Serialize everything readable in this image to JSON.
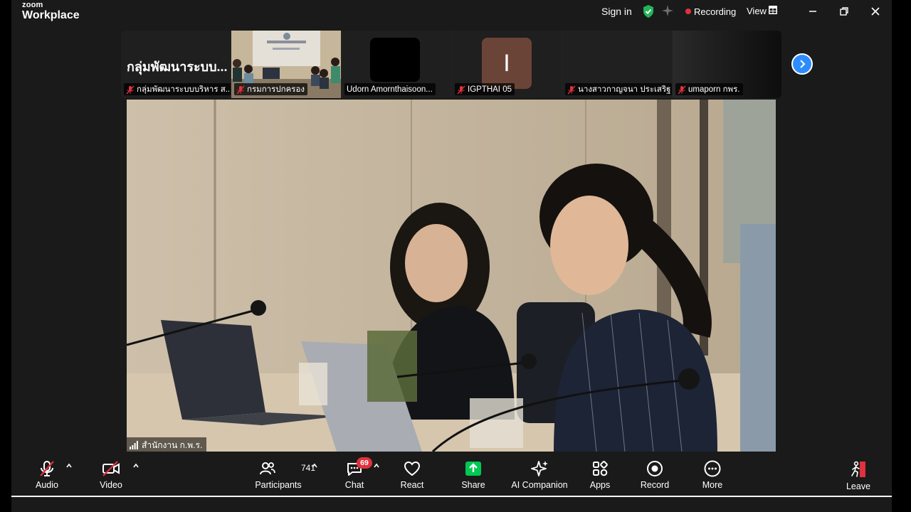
{
  "titlebar": {
    "brand_small": "zoom",
    "brand_large": "Workplace",
    "sign_in": "Sign in",
    "recording": "Recording",
    "view": "View"
  },
  "thumbnails": [
    {
      "name": "กลุ่มพัฒนาระบบบริหาร ส...",
      "big_text": "กลุ่มพัฒนาระบบ...",
      "type": "text"
    },
    {
      "name": "กรมการปกครอง",
      "type": "video"
    },
    {
      "name": "Udorn Amornthaisoon...",
      "type": "black"
    },
    {
      "name": "IGPTHAI 05",
      "avatar_letter": "I",
      "type": "avatar"
    },
    {
      "name": "นางสาวกาญจนา ประเสริฐ ...",
      "type": "empty"
    },
    {
      "name": "umaporn กพร.",
      "type": "dark"
    }
  ],
  "main_video": {
    "name": "สำนักงาน ก.พ.ร."
  },
  "toolbar": {
    "audio": "Audio",
    "video": "Video",
    "participants": "Participants",
    "participants_count": "741",
    "chat": "Chat",
    "chat_badge": "69",
    "react": "React",
    "share": "Share",
    "ai_companion": "AI Companion",
    "apps": "Apps",
    "record": "Record",
    "more": "More",
    "leave": "Leave"
  },
  "colors": {
    "accent_blue": "#2d8cff",
    "recording_red": "#e0323c",
    "share_green": "#00c853",
    "shield_green": "#23b45a"
  }
}
